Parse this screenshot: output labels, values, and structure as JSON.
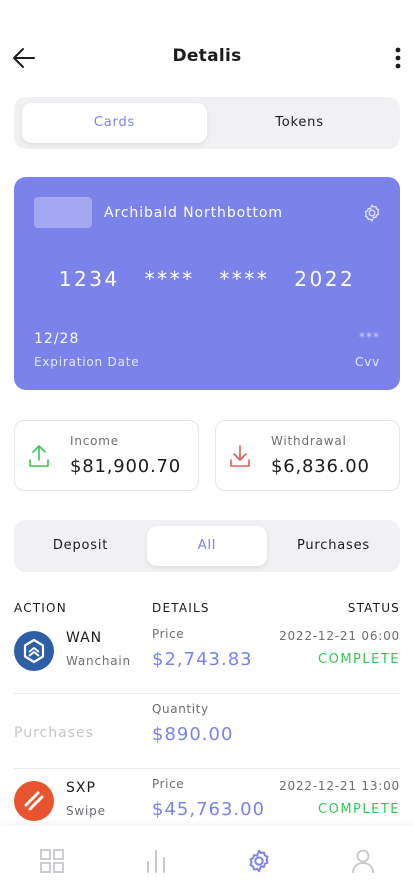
{
  "header": {
    "title": "Detalis"
  },
  "view_switch": {
    "options": [
      "Cards",
      "Tokens"
    ],
    "selected": "Cards"
  },
  "card": {
    "holder": "Archibald Northbottom",
    "number_groups": [
      "1234",
      "****",
      "****",
      "2022"
    ],
    "expiration": "12/28",
    "expiration_label": "Expiration Date",
    "cvv": "***",
    "cvv_label": "Cvv"
  },
  "stats": {
    "income": {
      "label": "Income",
      "value": "$81,900.70"
    },
    "withdrawal": {
      "label": "Withdrawal",
      "value": "$6,836.00"
    }
  },
  "filter": {
    "options": [
      "Deposit",
      "All",
      "Purchases"
    ],
    "selected": "All"
  },
  "table": {
    "headers": [
      "ACTION",
      "DETAILS",
      "STATUS"
    ],
    "rows": [
      {
        "symbol": "WAN",
        "name": "Wanchain",
        "icon": "wanchain-coin-icon",
        "detail_label": "Price",
        "detail_value": "$2,743.83",
        "date": "2022-12-21 06:00",
        "status": "COMPLETE"
      },
      {
        "action": "Purchases",
        "detail_label": "Quantity",
        "detail_value": "$890.00"
      },
      {
        "symbol": "SXP",
        "name": "Swipe",
        "icon": "swipe-coin-icon",
        "detail_label": "Price",
        "detail_value": "$45,763.00",
        "date": "2022-12-21 13:00",
        "status": "COMPLETE"
      }
    ]
  },
  "tabbar": {
    "items": [
      "grid-icon",
      "chart-icon",
      "gear-icon",
      "profile-icon"
    ],
    "active": "gear-icon"
  },
  "colors": {
    "accent": "#7b83eb",
    "success": "#34c759",
    "income_icon": "#34c759",
    "withdrawal_icon": "#e85656"
  }
}
